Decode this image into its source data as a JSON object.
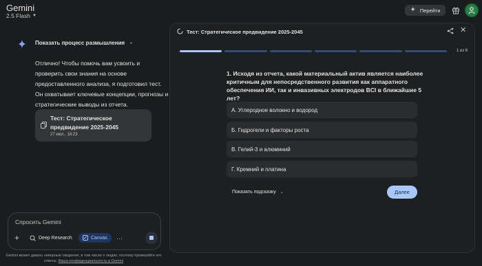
{
  "header": {
    "app_title": "Gemini",
    "model": "2.5 Flash",
    "go_label": "Перейти"
  },
  "chat": {
    "thinking_label": "Показать процесс размышления",
    "message": "Отлично! Чтобы помочь вам усвоить и проверить свои знания на основе предоставленного анализа, я подготовил тест. Он охватывает ключевые концепции, прогнозы и стратегические выводы из отчета.",
    "doc_card": {
      "title": "Тест: Стратегическое предвидение 2025-2045",
      "date": "27 июл., 18:23"
    }
  },
  "composer": {
    "placeholder": "Спросить Gemini",
    "deep_research": "Deep Research",
    "canvas": "Canvas",
    "more": "···"
  },
  "disclaimer": {
    "text": "Gemini может давать неверные сведения, в том числе о людях, поэтому проверяйте его ответы.",
    "link": "Ваша конфиденциальность и Gemini"
  },
  "panel": {
    "title": "Тест: Стратегическое предвидение 2025-2045",
    "counter": "1 из 6",
    "progress": {
      "current": 1,
      "total": 6
    },
    "question": "1. Исходя из отчета, какой материальный актив является наиболее критичным для непосредственного развития как аппаратного обеспечения ИИ, так и инвазивных электродов BCI в ближайшие 5 лет?",
    "options": [
      "А.  Углеродное волокно и водород",
      "Б.  Гидрогели и факторы роста",
      "В.  Гелий-3 и алюминий",
      "Г.  Кремний и платина"
    ],
    "hint_label": "Показать подсказку",
    "next_label": "Далее"
  },
  "colors": {
    "accent": "#a8c7fa",
    "background": "#1b1c1d",
    "panel": "#1e1f20",
    "option": "#2b2c2e"
  }
}
